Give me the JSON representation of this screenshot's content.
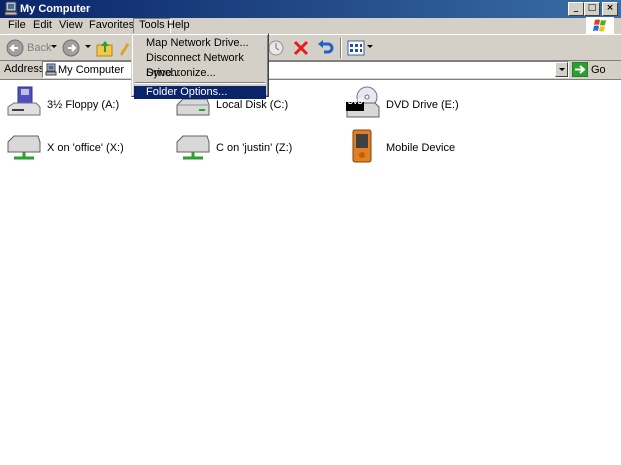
{
  "window": {
    "title": "My Computer",
    "controls": {
      "minimize": "_",
      "maximize": "□",
      "close": "×"
    }
  },
  "menubar": {
    "items": [
      "File",
      "Edit",
      "View",
      "Favorites",
      "Tools",
      "Help"
    ],
    "active": "Tools"
  },
  "toolbar": {
    "back_label": "Back",
    "icons": [
      "back-arrow-icon",
      "forward-arrow-icon",
      "up-folder-icon",
      "delete-x-icon",
      "undo-icon",
      "views-icon"
    ]
  },
  "address": {
    "label": "Address",
    "value": "My Computer",
    "go_label": "Go"
  },
  "tools_menu": {
    "items": [
      {
        "label": "Map Network Drive..."
      },
      {
        "label": "Disconnect Network Drive..."
      },
      {
        "label": "Synchronize..."
      },
      {
        "label": "Folder Options..."
      }
    ],
    "highlighted": "Folder Options..."
  },
  "drives": [
    {
      "label": "3½ Floppy (A:)",
      "icon": "floppy-drive-icon"
    },
    {
      "label": "Local Disk (C:)",
      "icon": "hard-disk-icon"
    },
    {
      "label": "DVD Drive (E:)",
      "icon": "dvd-drive-icon",
      "badge": "DVD"
    },
    {
      "label": "X on 'office' (X:)",
      "icon": "network-drive-icon"
    },
    {
      "label": "C on 'justin' (Z:)",
      "icon": "network-drive-icon"
    },
    {
      "label": "Mobile Device",
      "icon": "mobile-device-icon"
    }
  ],
  "colors": {
    "title_bar": "#0a246a",
    "menu_highlight": "#0a246a",
    "chrome": "#d4d0c8"
  }
}
